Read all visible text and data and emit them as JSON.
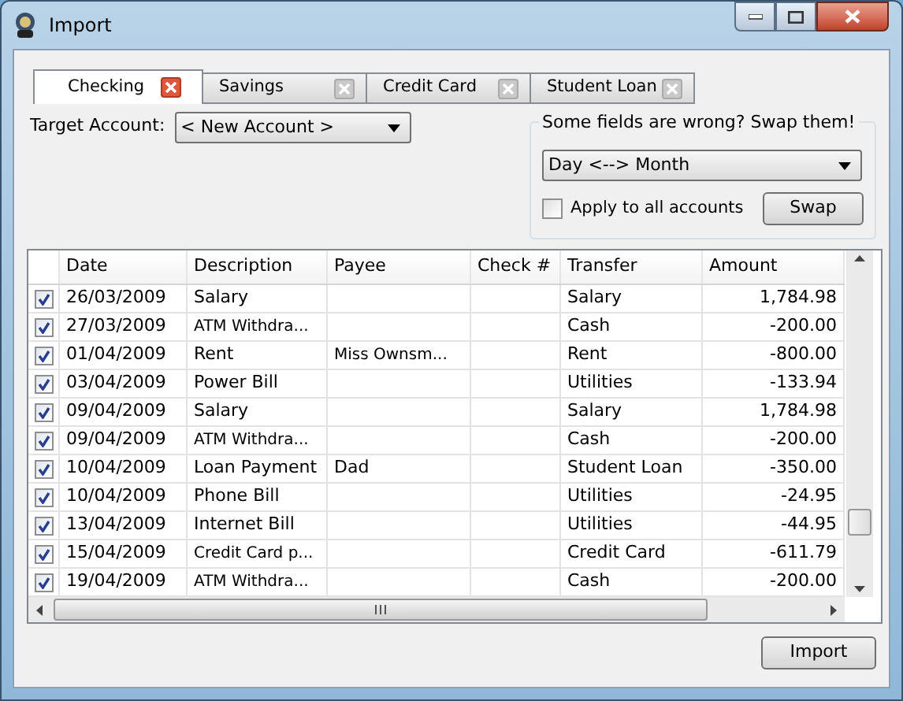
{
  "window": {
    "title": "Import"
  },
  "tabs": [
    {
      "label": "Checking",
      "selected": true
    },
    {
      "label": "Savings",
      "selected": false
    },
    {
      "label": "Credit Card",
      "selected": false
    },
    {
      "label": "Student Loan",
      "selected": false
    }
  ],
  "target_account": {
    "label": "Target Account:",
    "value": "< New Account >"
  },
  "swap_group": {
    "title": "Some fields are wrong? Swap them!",
    "swap_option": "Day <--> Month",
    "apply_all": {
      "label": "Apply to all accounts",
      "checked": false
    },
    "button": "Swap"
  },
  "table": {
    "columns": [
      "Date",
      "Description",
      "Payee",
      "Check #",
      "Transfer",
      "Amount"
    ],
    "rows": [
      {
        "checked": true,
        "cells": [
          "26/03/2009",
          "Salary",
          "",
          "",
          "Salary",
          "1,784.98"
        ]
      },
      {
        "checked": true,
        "cells": [
          "27/03/2009",
          "ATM Withdra...",
          "",
          "",
          "Cash",
          "-200.00"
        ]
      },
      {
        "checked": true,
        "cells": [
          "01/04/2009",
          "Rent",
          "Miss Ownsm...",
          "",
          "Rent",
          "-800.00"
        ]
      },
      {
        "checked": true,
        "cells": [
          "03/04/2009",
          "Power Bill",
          "",
          "",
          "Utilities",
          "-133.94"
        ]
      },
      {
        "checked": true,
        "cells": [
          "09/04/2009",
          "Salary",
          "",
          "",
          "Salary",
          "1,784.98"
        ]
      },
      {
        "checked": true,
        "cells": [
          "09/04/2009",
          "ATM Withdra...",
          "",
          "",
          "Cash",
          "-200.00"
        ]
      },
      {
        "checked": true,
        "cells": [
          "10/04/2009",
          "Loan Payment",
          "Dad",
          "",
          "Student Loan",
          "-350.00"
        ]
      },
      {
        "checked": true,
        "cells": [
          "10/04/2009",
          "Phone Bill",
          "",
          "",
          "Utilities",
          "-24.95"
        ]
      },
      {
        "checked": true,
        "cells": [
          "13/04/2009",
          "Internet Bill",
          "",
          "",
          "Utilities",
          "-44.95"
        ]
      },
      {
        "checked": true,
        "cells": [
          "15/04/2009",
          "Credit Card p...",
          "",
          "",
          "Credit Card",
          "-611.79"
        ]
      },
      {
        "checked": true,
        "cells": [
          "19/04/2009",
          "ATM Withdra...",
          "",
          "",
          "Cash",
          "-200.00"
        ]
      }
    ]
  },
  "import_button": "Import"
}
